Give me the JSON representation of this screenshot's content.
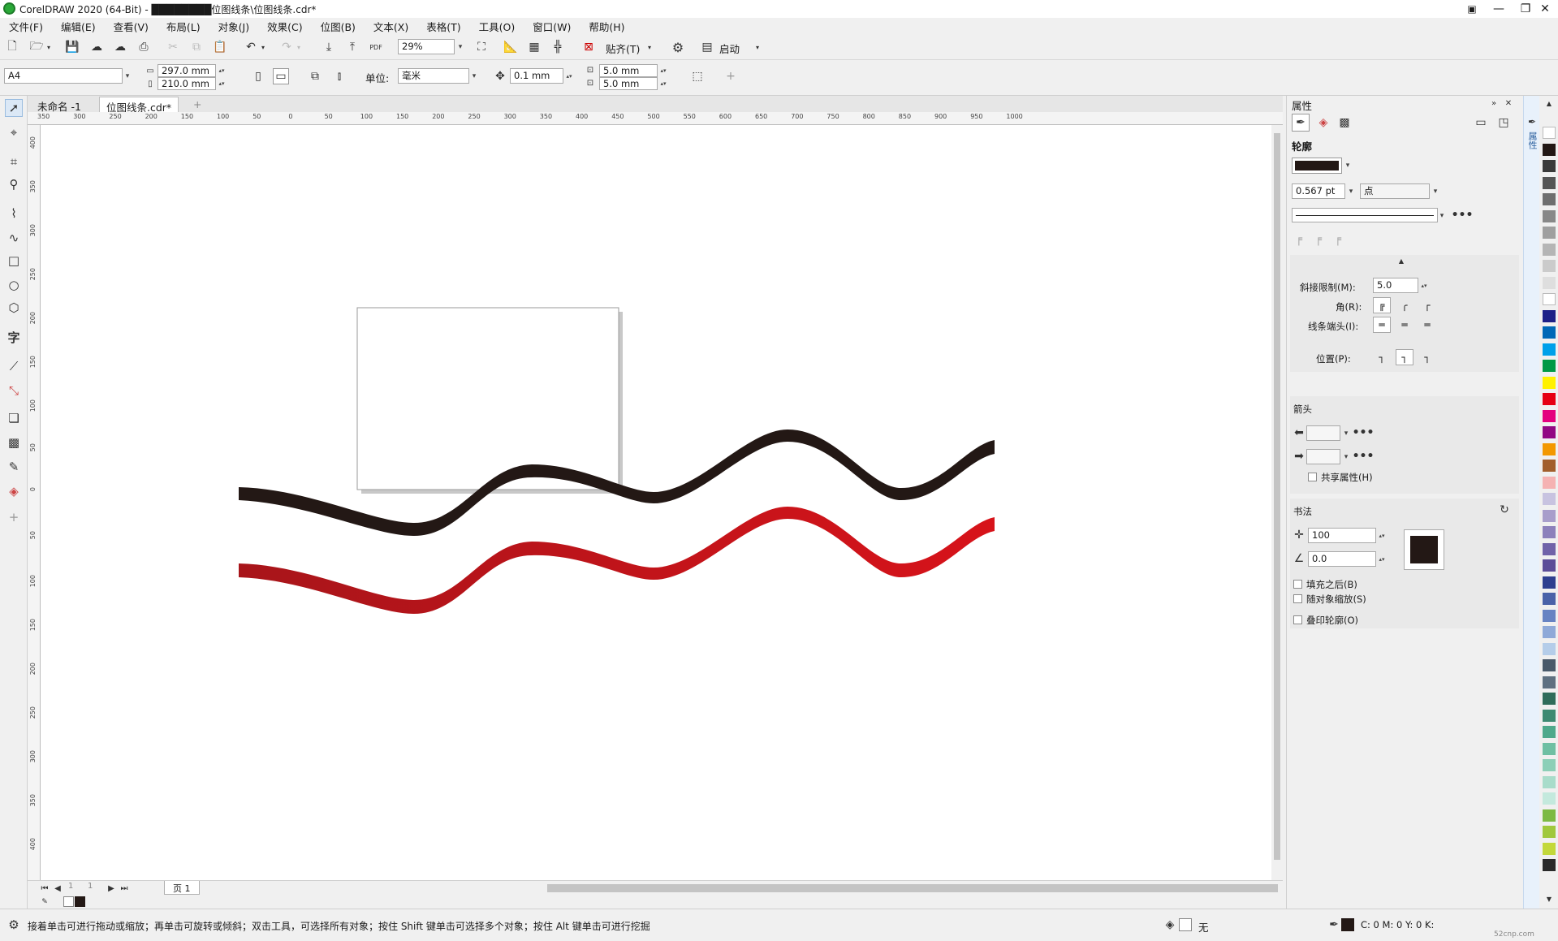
{
  "window": {
    "title": "CorelDRAW 2020 (64-Bit) - ████████位图线条\\位图线条.cdr*",
    "controls": [
      "—",
      "❐",
      "✕"
    ]
  },
  "menu": [
    "文件(F)",
    "编辑(E)",
    "查看(V)",
    "布局(L)",
    "对象(J)",
    "效果(C)",
    "位图(B)",
    "文本(X)",
    "表格(T)",
    "工具(O)",
    "窗口(W)",
    "帮助(H)"
  ],
  "toolbar": {
    "zoom": "29%",
    "snap_label": "贴齐(T)",
    "launch_label": "启动",
    "pdf": "PDF"
  },
  "propbar": {
    "page_size": "A4",
    "width": "297.0 mm",
    "height": "210.0 mm",
    "units_label": "单位:",
    "units_value": "毫米",
    "nudge": "0.1 mm",
    "dup_x": "5.0 mm",
    "dup_y": "5.0 mm"
  },
  "tabs": [
    "未命名 -1",
    "位图线条.cdr*"
  ],
  "ruler_h": [
    "350",
    "300",
    "250",
    "200",
    "150",
    "100",
    "50",
    "0",
    "50",
    "100",
    "150",
    "200",
    "250",
    "300",
    "350",
    "400",
    "450",
    "500",
    "550",
    "600",
    "650",
    "700",
    "750",
    "800",
    "850",
    "900",
    "950",
    "1000"
  ],
  "ruler_v": [
    "400",
    "350",
    "300",
    "250",
    "200",
    "150",
    "100",
    "50",
    "0",
    "50",
    "100",
    "150",
    "200",
    "250",
    "300",
    "350",
    "400"
  ],
  "pagebar": {
    "page_num": "1",
    "of": "1",
    "page_tab": "页 1"
  },
  "status": {
    "hint": "接着单击可进行拖动或缩放；再单击可旋转或倾斜；双击工具，可选择所有对象；按住 Shift 键单击可选择多个对象；按住 Alt 键单击可进行挖掘",
    "fill_label": "无",
    "cmyk": "C: 0 M: 0 Y: 0 K:",
    "watermark": "52cnp.com"
  },
  "properties": {
    "title": "属性",
    "side_tab": "属性",
    "outline_header": "轮廓",
    "outline_color": "#231815",
    "width_value": "0.567 pt",
    "width_unit": "点",
    "miter_label": "斜接限制(M):",
    "miter_value": "5.0",
    "corner_label": "角(R):",
    "cap_label": "线条端头(I):",
    "position_label": "位置(P):",
    "arrows_header": "箭头",
    "share_attr": "共享属性(H)",
    "calligraphy_header": "书法",
    "stretch_value": "100",
    "angle_value": "0.0",
    "fill_after": "填充之后(B)",
    "scale_with_obj": "随对象缩放(S)",
    "overprint": "叠印轮廓(O)"
  },
  "colors": {
    "wave_black": "#231815",
    "wave_red": "#d7131a",
    "red_dark": "#a8151a"
  },
  "palette": [
    "#ffffff",
    "#231815",
    "#3a3a3a",
    "#555555",
    "#6e6e6e",
    "#888888",
    "#9f9f9f",
    "#b5b5b5",
    "#cbcbcb",
    "#dedede",
    "#ffffff",
    "#1d2088",
    "#0068b7",
    "#00a0e9",
    "#009944",
    "#fff100",
    "#e60012",
    "#e4007f",
    "#920783",
    "#f39800",
    "#a25f2c",
    "#f5b2b2",
    "#c8c3e0",
    "#a89ecb",
    "#8c80bb",
    "#7062a8",
    "#5c4d98",
    "#2e3f8f",
    "#4a62a8",
    "#6783c3",
    "#8fa9d8",
    "#b5cde9",
    "#4a5a6a",
    "#5f7080",
    "#2f6c5a",
    "#3e8a72",
    "#4fa98b",
    "#6fbfa3",
    "#8ccfb7",
    "#a8dcca",
    "#c4e9dd",
    "#7dba43",
    "#a0c83c",
    "#c3d83a",
    "#2a2a2a"
  ]
}
